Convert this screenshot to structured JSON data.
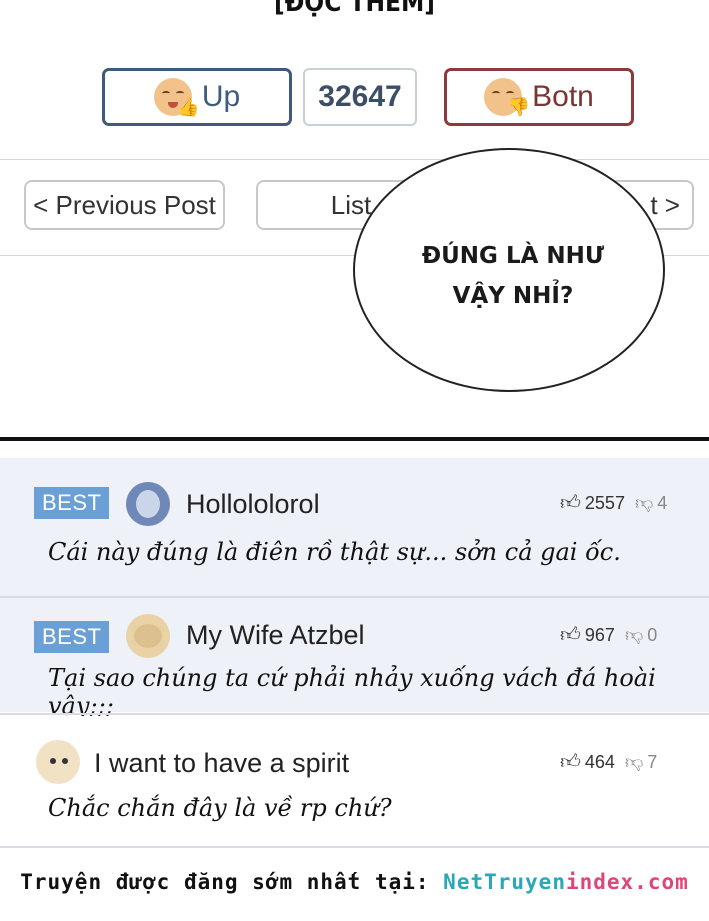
{
  "top_title": "[ĐỌC THÊM]",
  "vote": {
    "up_label": "Up",
    "count": "32647",
    "down_label": "Botn"
  },
  "nav": {
    "prev_label": "< Previous Post",
    "list_label": "List",
    "next_label": "t >"
  },
  "bubble": {
    "line1": "ĐÚNG LÀ NHƯ",
    "line2": "VẬY NHỈ?"
  },
  "comments": [
    {
      "badge": "BEST",
      "username": "Hollololorol",
      "likes": "2557",
      "dislikes": "4",
      "text": "Cái này đúng là điên rồ thật sự... sởn cả gai ốc."
    },
    {
      "badge": "BEST",
      "username": "My Wife Atzbel",
      "likes": "967",
      "dislikes": "0",
      "text": "Tại sao chúng ta cứ phải nhảy xuống vách đá hoài vậy;;;"
    },
    {
      "username": "I want to have a spirit",
      "likes": "464",
      "dislikes": "7",
      "text": "Chắc chắn đây là về rp chứ?"
    }
  ],
  "footer": {
    "prefix": "Truyện được đăng sớm nhất tại: ",
    "site_a": "NetTruyen",
    "site_b": "index.com"
  },
  "colors": {
    "up_border": "#3f5a7c",
    "down_border": "#8e3a3a",
    "best_badge": "#6aa0d6",
    "comment_bg": "#eef1f8"
  },
  "icons": {
    "up_face": "laughing-face-thumbs-up-icon",
    "down_face": "smirk-face-thumbs-down-icon",
    "like": "thumbs-up-icon",
    "dislike": "thumbs-down-icon"
  }
}
